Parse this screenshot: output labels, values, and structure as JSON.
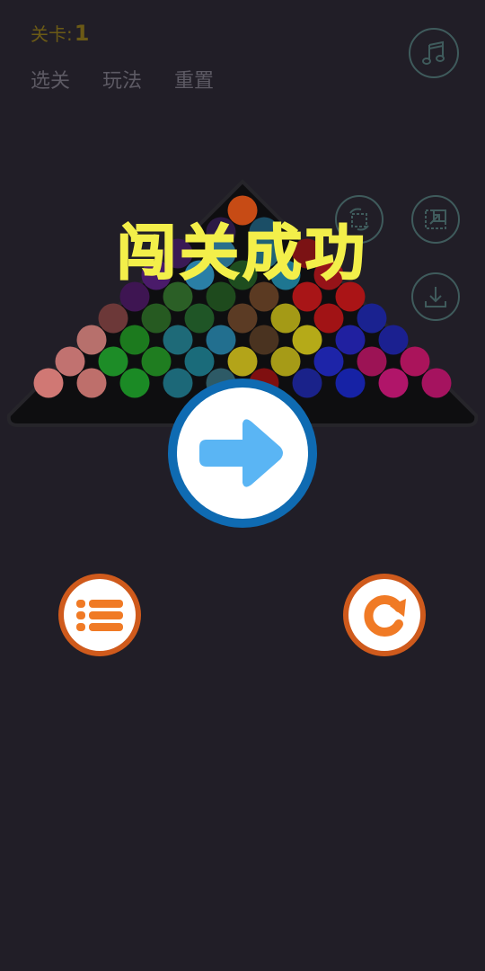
{
  "header": {
    "level_label": "关卡:",
    "level_number": "1",
    "menu": [
      "选关",
      "玩法",
      "重置"
    ]
  },
  "overlay": {
    "title": "闯关成功"
  },
  "icons": {
    "music": "music-note-icon",
    "swap": "swap-icon",
    "export": "export-icon",
    "download": "download-icon",
    "next": "arrow-right-icon",
    "levels": "list-icon",
    "restart": "restart-icon"
  },
  "colors": {
    "background": "#211e27",
    "title": "#f3ef4a",
    "next_ring": "#0f6bb2",
    "next_arrow": "#5ab5f4",
    "orange": "#f07a25"
  },
  "balls": [
    [
      "#c74b15"
    ],
    [
      "#2c1a45",
      "#1b4e66"
    ],
    [
      "#3a1a55",
      "#2a6f8c",
      "#1f6276",
      "#7b1214"
    ],
    [
      "#4a1b6a",
      "#2a7fa6",
      "#1e4d1f",
      "#1e7691",
      "#961318"
    ],
    [
      "#3e1552",
      "#2b5f26",
      "#1e4a1d",
      "#5b3a22",
      "#a81517",
      "#aa1416"
    ],
    [
      "#6c3838",
      "#265a21",
      "#1f5526",
      "#5b3b24",
      "#a49a16",
      "#a11315",
      "#1a2290"
    ],
    [
      "#b7706c",
      "#1c7a1e",
      "#1e6a78",
      "#226f8f",
      "#4a3320",
      "#b5aa18",
      "#2020a0",
      "#1b2090"
    ],
    [
      "#c17270",
      "#1d8c27",
      "#1f7d20",
      "#1a6b7a",
      "#b3a419",
      "#a69b17",
      "#1d24a8",
      "#9c1355",
      "#aa145b"
    ],
    [
      "#d07874",
      "#be6f6b",
      "#1b8a25",
      "#1c6878",
      "#2d5a66",
      "#7f0f10",
      "#1a228a",
      "#1622a5",
      "#b01569",
      "#a5135f"
    ]
  ]
}
